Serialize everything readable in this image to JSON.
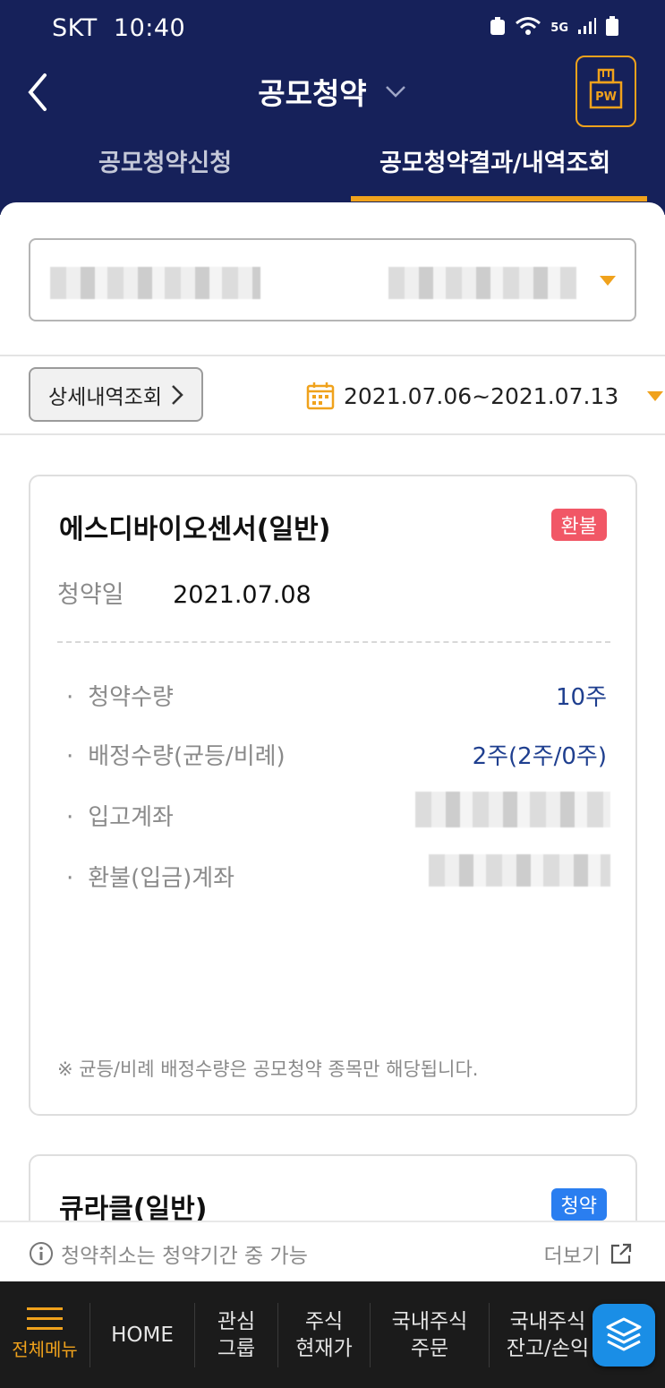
{
  "status_bar": {
    "carrier": "SKT",
    "time": "10:40",
    "network": "5G"
  },
  "header": {
    "title": "공모청약",
    "pw_label": "PW"
  },
  "tabs": [
    {
      "label": "공모청약신청",
      "active": false
    },
    {
      "label": "공모청약결과/내역조회",
      "active": true
    }
  ],
  "filter": {
    "detail_label": "상세내역조회",
    "date_range": "2021.07.06~2021.07.13"
  },
  "cards": [
    {
      "title": "에스디바이오센서(일반)",
      "badge": "환불",
      "date_label": "청약일",
      "date_value": "2021.07.08",
      "rows": [
        {
          "label": "청약수량",
          "value": "10주"
        },
        {
          "label": "배정수량(균등/비례)",
          "value": "2주(2주/0주)"
        },
        {
          "label": "입고계좌",
          "value": ""
        },
        {
          "label": "환불(입금)계좌",
          "value": ""
        }
      ],
      "note": "※ 균등/비례 배정수량은 공모청약 종목만 해당됩니다."
    },
    {
      "title": "큐라클(일반)",
      "badge": "청약"
    }
  ],
  "notice": {
    "text": "청약취소는 청약기간 중 가능",
    "more": "더보기"
  },
  "bottom_nav": {
    "menu": "전체메뉴",
    "items": [
      {
        "line1": "HOME",
        "line2": ""
      },
      {
        "line1": "관심",
        "line2": "그룹"
      },
      {
        "line1": "주식",
        "line2": "현재가"
      },
      {
        "line1": "국내주식",
        "line2": "주문"
      },
      {
        "line1": "국내주식",
        "line2": "잔고/손익"
      }
    ]
  },
  "colors": {
    "navy": "#16215a",
    "accent": "#f0a21c",
    "refund_badge": "#f15766",
    "apply_badge": "#2a7ef0",
    "value_blue": "#1f3f8f"
  }
}
